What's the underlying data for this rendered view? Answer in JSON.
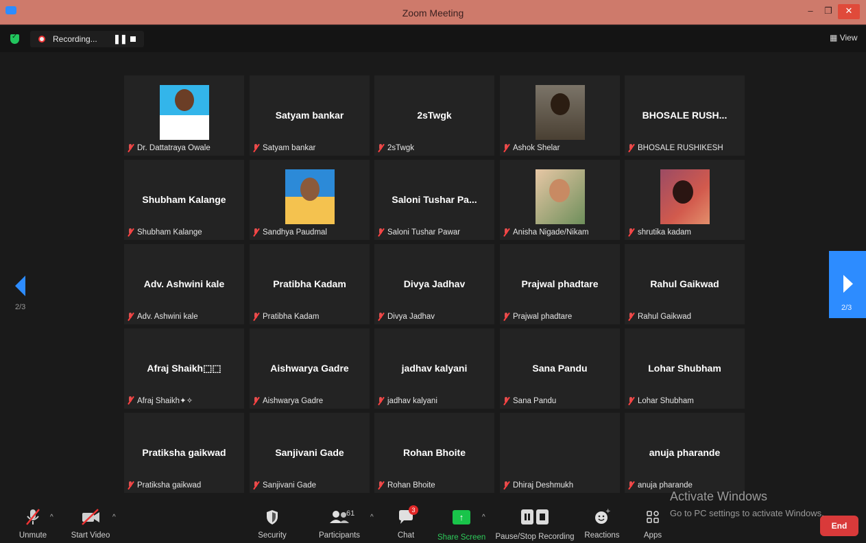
{
  "window": {
    "title": "Zoom Meeting",
    "minimize": "–",
    "maximize": "❐",
    "close": "✕"
  },
  "topbar": {
    "recording_label": "Recording...",
    "pause_glyph": "❚❚",
    "view_label": "View",
    "view_icon": "grid-icon"
  },
  "gallery": {
    "tiles": [
      {
        "display": "",
        "label": "Dr. Dattatraya Owale",
        "photo": true
      },
      {
        "display": "Satyam bankar",
        "label": "Satyam bankar",
        "photo": false
      },
      {
        "display": "2sTwgk",
        "label": "2sTwgk",
        "photo": false
      },
      {
        "display": "",
        "label": "Ashok Shelar",
        "photo": true
      },
      {
        "display": "BHOSALE RUSH...",
        "label": "BHOSALE RUSHIKESH",
        "photo": false
      },
      {
        "display": "Shubham Kalange",
        "label": "Shubham Kalange",
        "photo": false
      },
      {
        "display": "",
        "label": "Sandhya Paudmal",
        "photo": true
      },
      {
        "display": "Saloni Tushar Pa...",
        "label": "Saloni Tushar Pawar",
        "photo": false
      },
      {
        "display": "",
        "label": "Anisha Nigade/Nikam",
        "photo": true
      },
      {
        "display": "",
        "label": "shrutika kadam",
        "photo": true
      },
      {
        "display": "Adv. Ashwini kale",
        "label": "Adv. Ashwini kale",
        "photo": false
      },
      {
        "display": "Pratibha Kadam",
        "label": "Pratibha Kadam",
        "photo": false
      },
      {
        "display": "Divya Jadhav",
        "label": "Divya Jadhav",
        "photo": false
      },
      {
        "display": "Prajwal phadtare",
        "label": "Prajwal phadtare",
        "photo": false
      },
      {
        "display": "Rahul Gaikwad",
        "label": "Rahul Gaikwad",
        "photo": false
      },
      {
        "display": "Afraj Shaikh⬚⬚",
        "label": "Afraj Shaikh✦✧",
        "photo": false
      },
      {
        "display": "Aishwarya Gadre",
        "label": "Aishwarya Gadre",
        "photo": false
      },
      {
        "display": "jadhav kalyani",
        "label": "jadhav kalyani",
        "photo": false
      },
      {
        "display": "Sana Pandu",
        "label": "Sana Pandu",
        "photo": false
      },
      {
        "display": "Lohar Shubham",
        "label": "Lohar Shubham",
        "photo": false
      },
      {
        "display": "Pratiksha gaikwad",
        "label": "Pratiksha gaikwad",
        "photo": false
      },
      {
        "display": "Sanjivani Gade",
        "label": "Sanjivani Gade",
        "photo": false
      },
      {
        "display": "Rohan Bhoite",
        "label": "Rohan Bhoite",
        "photo": false
      },
      {
        "display": "",
        "label": "Dhiraj Deshmukh",
        "photo": true
      },
      {
        "display": "anuja pharande",
        "label": "anuja pharande",
        "photo": false
      }
    ]
  },
  "nav": {
    "left_page": "2/3",
    "right_page": "2/3"
  },
  "toolbar": {
    "unmute": "Unmute",
    "start_video": "Start Video",
    "security": "Security",
    "participants": "Participants",
    "participants_count": "61",
    "chat": "Chat",
    "chat_badge": "3",
    "share_screen": "Share Screen",
    "pause_recording": "Pause/Stop Recording",
    "reactions": "Reactions",
    "apps": "Apps",
    "end": "End",
    "caret": "^"
  },
  "watermark": {
    "line1": "Activate Windows",
    "line2": "Go to PC settings to activate Windows."
  },
  "colors": {
    "accent_blue": "#2d8cff",
    "share_green": "#19c44a",
    "end_red": "#d93a3a",
    "titlebar": "#ce7a6b"
  }
}
